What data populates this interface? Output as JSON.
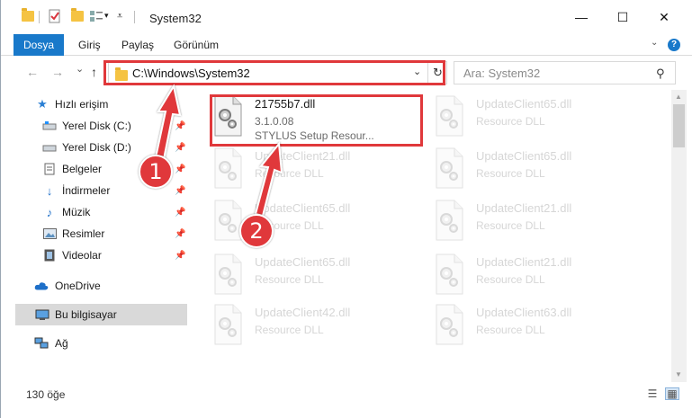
{
  "window": {
    "title": "System32",
    "controls": {
      "minimize": "—",
      "maximize": "☐",
      "close": "✕"
    }
  },
  "ribbon": {
    "tabs": [
      "Dosya",
      "Giriş",
      "Paylaş",
      "Görünüm"
    ]
  },
  "navigation": {
    "back": "←",
    "forward": "→",
    "recent": "⌄",
    "up": "↑",
    "address": "C:\\Windows\\System32",
    "search_placeholder": "Ara: System32"
  },
  "sidebar": {
    "items": [
      {
        "label": "Hızlı erişim",
        "icon": "star-icon",
        "pinned": false
      },
      {
        "label": "Yerel Disk (C:)",
        "icon": "drive-icon",
        "pinned": true
      },
      {
        "label": "Yerel Disk (D:)",
        "icon": "drive-icon",
        "pinned": true
      },
      {
        "label": "Belgeler",
        "icon": "documents-icon",
        "pinned": true
      },
      {
        "label": "İndirmeler",
        "icon": "download-icon",
        "pinned": true
      },
      {
        "label": "Müzik",
        "icon": "music-icon",
        "pinned": true
      },
      {
        "label": "Resimler",
        "icon": "pictures-icon",
        "pinned": true
      },
      {
        "label": "Videolar",
        "icon": "videos-icon",
        "pinned": true
      },
      {
        "label": "OneDrive",
        "icon": "cloud-icon",
        "pinned": false
      },
      {
        "label": "Bu bilgisayar",
        "icon": "computer-icon",
        "pinned": false,
        "selected": true
      },
      {
        "label": "Ağ",
        "icon": "network-icon",
        "pinned": false
      }
    ]
  },
  "files": [
    {
      "name": "21755b7.dll",
      "version": "3.1.0.08",
      "description": "STYLUS Setup Resour...",
      "highlighted": true
    },
    {
      "name": "UpdateClient65.dll",
      "description": "Resource DLL"
    },
    {
      "name": "UpdateClient21.dll",
      "description": "Resource DLL"
    },
    {
      "name": "UpdateClient65.dll",
      "description": "Resource DLL"
    },
    {
      "name": "UpdateClient65.dll",
      "description": "Resource DLL"
    },
    {
      "name": "UpdateClient21.dll",
      "description": "Resource DLL"
    },
    {
      "name": "UpdateClient65.dll",
      "description": "Resource DLL"
    },
    {
      "name": "UpdateClient21.dll",
      "description": "Resource DLL"
    },
    {
      "name": "UpdateClient42.dll",
      "description": "Resource DLL"
    },
    {
      "name": "UpdateClient63.dll",
      "description": "Resource DLL"
    }
  ],
  "status": {
    "item_count": "130 öğe"
  },
  "callouts": [
    "1",
    "2"
  ],
  "colors": {
    "accent": "#1979ca",
    "highlight": "#e0383b",
    "selected_bg": "#d9d9d9"
  }
}
